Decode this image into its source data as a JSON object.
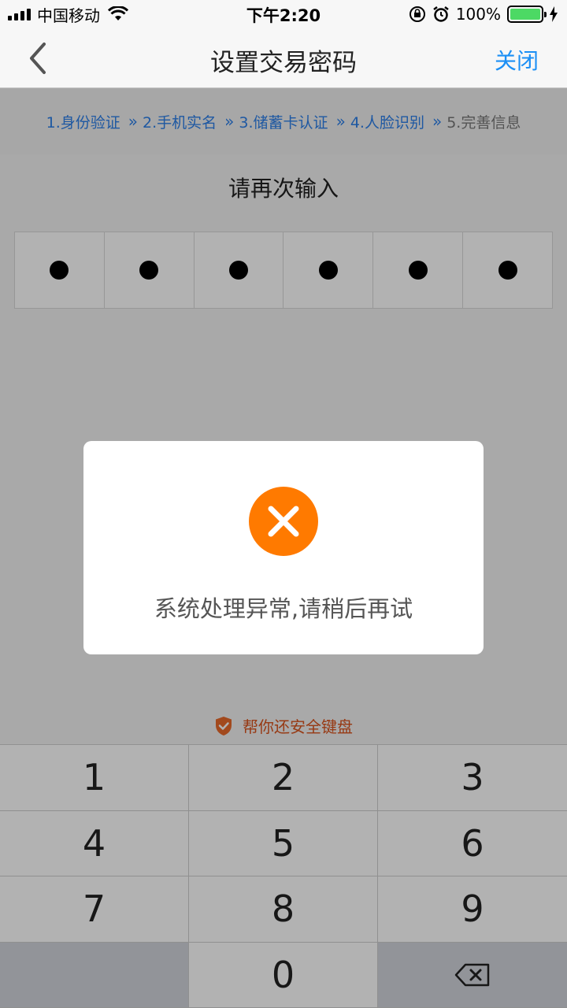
{
  "status_bar": {
    "carrier": "中国移动",
    "time": "下午2:20",
    "battery": "100%",
    "battery_level": 1.0
  },
  "nav": {
    "title": "设置交易密码",
    "close_label": "关闭"
  },
  "steps": [
    {
      "label": "1.身份验证",
      "active": true
    },
    {
      "label": "2.手机实名",
      "active": true
    },
    {
      "label": "3.储蓄卡认证",
      "active": true
    },
    {
      "label": "4.人脸识别",
      "active": true
    },
    {
      "label": "5.完善信息",
      "active": false
    }
  ],
  "step_separator": "»",
  "prompt": "请再次输入",
  "pin_dots": [
    "●",
    "●",
    "●",
    "●",
    "●",
    "●"
  ],
  "keyboard": {
    "title": "帮你还安全键盘",
    "keys": [
      "1",
      "2",
      "3",
      "4",
      "5",
      "6",
      "7",
      "8",
      "9",
      "",
      "0",
      "⌫"
    ]
  },
  "dialog": {
    "message": "系统处理异常,请稍后再试"
  },
  "colors": {
    "accent": "#1b8ff5",
    "step_blue": "#2c7fe8",
    "error_orange": "#ff7a00",
    "shield_orange": "#e8692a"
  }
}
